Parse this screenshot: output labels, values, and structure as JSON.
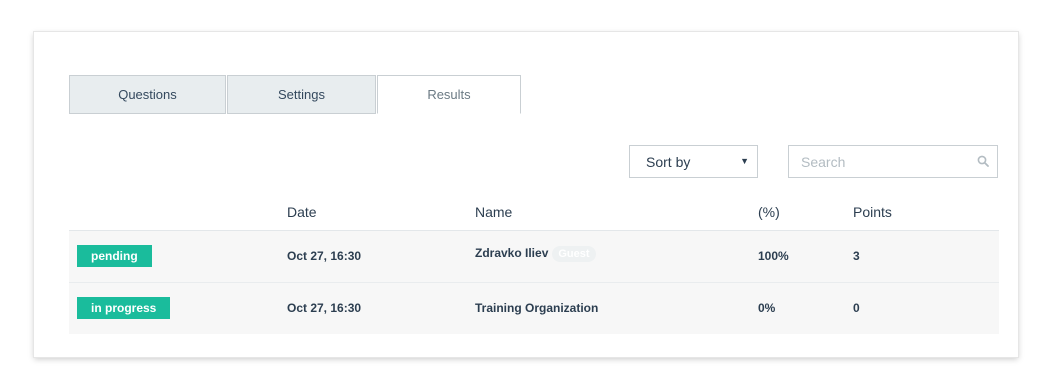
{
  "tabs": [
    {
      "label": "Questions"
    },
    {
      "label": "Settings"
    },
    {
      "label": "Results"
    }
  ],
  "toolbar": {
    "sort_label": "Sort by",
    "search_placeholder": "Search"
  },
  "table": {
    "headers": {
      "date": "Date",
      "name": "Name",
      "percent": "(%)",
      "points": "Points"
    },
    "rows": [
      {
        "status": "pending",
        "date": "Oct 27, 16:30",
        "name": "Zdravko Iliev",
        "tag": "Guest",
        "percent": "100%",
        "points": "3"
      },
      {
        "status": "in progress",
        "date": "Oct 27, 16:30",
        "name": "Training Organization",
        "percent": "0%",
        "points": "0"
      }
    ]
  },
  "colors": {
    "accent": "#1abc9c",
    "tab_inactive_bg": "#e8edef",
    "row_bg": "#f7f7f7",
    "text": "#2c3e50"
  },
  "icons": {
    "search": "search-icon",
    "sort_caret": "caret-down-icon"
  }
}
